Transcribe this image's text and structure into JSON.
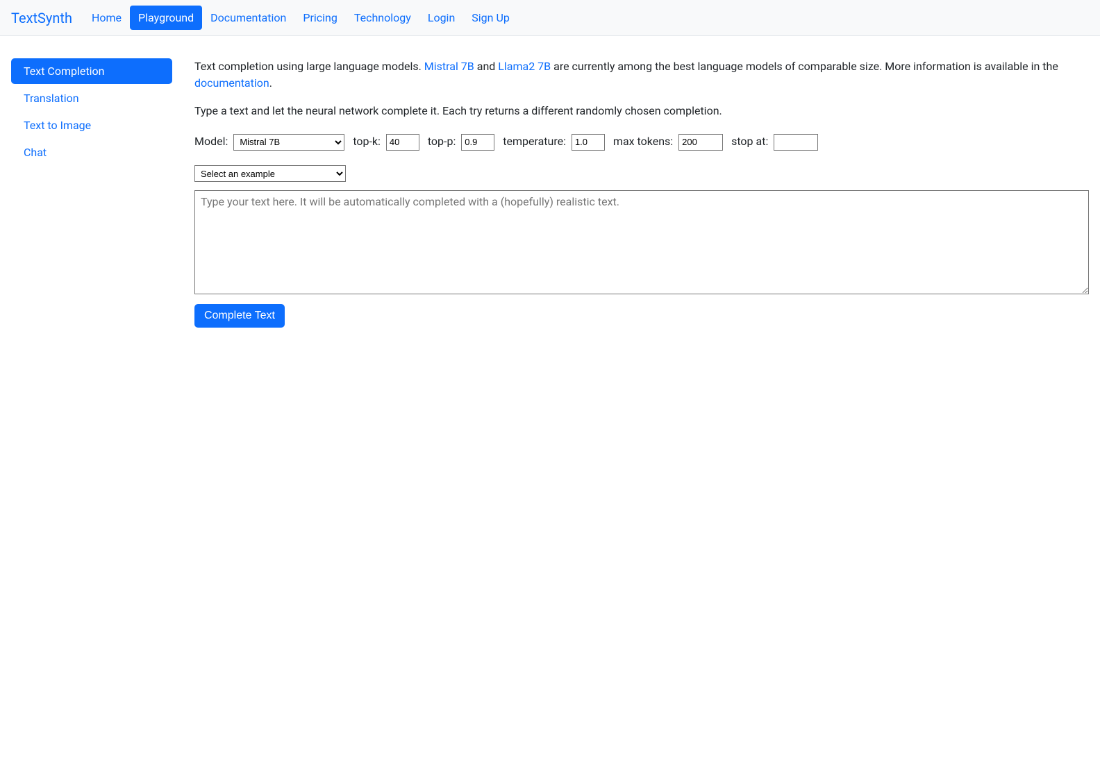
{
  "brand": "TextSynth",
  "nav": [
    {
      "label": "Home",
      "active": false
    },
    {
      "label": "Playground",
      "active": true
    },
    {
      "label": "Documentation",
      "active": false
    },
    {
      "label": "Pricing",
      "active": false
    },
    {
      "label": "Technology",
      "active": false
    },
    {
      "label": "Login",
      "active": false
    },
    {
      "label": "Sign Up",
      "active": false
    }
  ],
  "sidebar": [
    {
      "label": "Text Completion",
      "active": true
    },
    {
      "label": "Translation",
      "active": false
    },
    {
      "label": "Text to Image",
      "active": false
    },
    {
      "label": "Chat",
      "active": false
    }
  ],
  "intro": {
    "prefix": "Text completion using large language models. ",
    "link1": "Mistral 7B",
    "mid1": " and ",
    "link2": "Llama2 7B",
    "mid2": " are currently among the best language models of comparable size. More information is available in the ",
    "link3": "documentation",
    "suffix": "."
  },
  "instruction": "Type a text and let the neural network complete it. Each try returns a different randomly chosen completion.",
  "controls": {
    "model_label": "Model:",
    "model_value": "Mistral 7B",
    "topk_label": "top-k:",
    "topk_value": "40",
    "topp_label": "top-p:",
    "topp_value": "0.9",
    "temperature_label": "temperature:",
    "temperature_value": "1.0",
    "maxtokens_label": "max tokens:",
    "maxtokens_value": "200",
    "stopat_label": "stop at:",
    "stopat_value": ""
  },
  "example_select": "Select an example",
  "textarea_placeholder": "Type your text here. It will be automatically completed with a (hopefully) realistic text.",
  "textarea_value": "",
  "complete_button": "Complete Text"
}
